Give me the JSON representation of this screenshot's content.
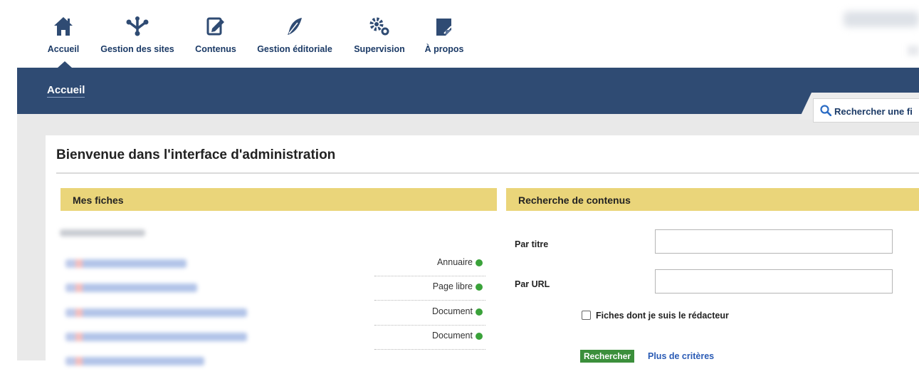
{
  "nav": {
    "items": [
      {
        "label": "Accueil",
        "icon": "home-icon"
      },
      {
        "label": "Gestion des sites",
        "icon": "sites-network-icon"
      },
      {
        "label": "Contenus",
        "icon": "edit-content-icon"
      },
      {
        "label": "Gestion éditoriale",
        "icon": "feather-icon"
      },
      {
        "label": "Supervision",
        "icon": "gears-icon"
      },
      {
        "label": "À propos",
        "icon": "about-icon"
      }
    ],
    "active": "Accueil"
  },
  "header": {
    "title": "Accueil"
  },
  "search_tab": {
    "label": "Rechercher une fi",
    "icon": "search-icon"
  },
  "main": {
    "welcome": "Bienvenue dans l'interface d'administration",
    "my_sheets": {
      "title": "Mes fiches",
      "items": [
        {
          "type": "Annuaire",
          "status": "green"
        },
        {
          "type": "Page libre",
          "status": "green"
        },
        {
          "type": "Document",
          "status": "green"
        },
        {
          "type": "Document",
          "status": "green"
        }
      ]
    },
    "content_search": {
      "title": "Recherche de contenus",
      "by_title_label": "Par titre",
      "by_title_value": "",
      "by_url_label": "Par URL",
      "by_url_value": "",
      "author_checkbox_label": "Fiches dont je suis le rédacteur",
      "author_checked": false,
      "search_button": "Rechercher",
      "more_criteria": "Plus de critères"
    }
  },
  "colors": {
    "navy": "#2f4b73",
    "section_header": "#ead57a",
    "status_green": "#3aa23a",
    "button_green": "#3b8f3b",
    "link_blue": "#2a5bb5"
  }
}
